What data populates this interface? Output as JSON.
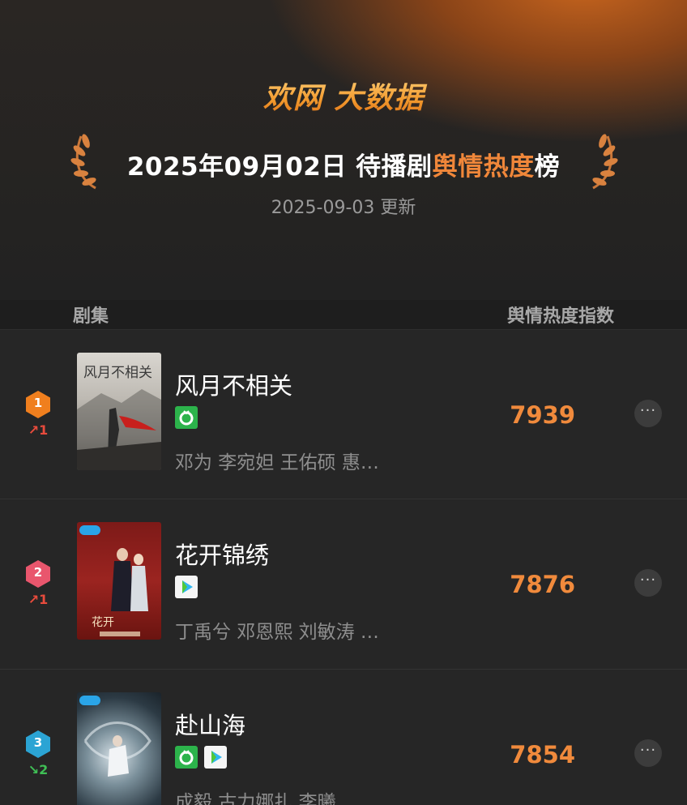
{
  "header": {
    "brand": "欢网 大数据",
    "title_prefix": "2025年09月02日 待播剧",
    "title_highlight": "舆情热度",
    "title_suffix": "榜",
    "updated": "2025-09-03 更新"
  },
  "columns": {
    "left": "剧集",
    "right": "舆情热度指数"
  },
  "colors": {
    "accent": "#f0873a",
    "rank1": "#f07f1e",
    "rank2": "#e9566d",
    "rank3": "#2ba4d4",
    "trend_up": "#e84b3c",
    "trend_down": "#3fbf55"
  },
  "rows": [
    {
      "rank": "1",
      "trend": "↗1",
      "trend_dir": "up",
      "poster_text": "风月不相关",
      "title": "风月不相关",
      "platforms": [
        "iqiyi-icon"
      ],
      "cast": "邓为 李宛妲 王佑硕 惠…",
      "score": "7939"
    },
    {
      "rank": "2",
      "trend": "↗1",
      "trend_dir": "up",
      "poster_text": "",
      "title": "花开锦绣",
      "platforms": [
        "tencent-video-icon"
      ],
      "cast": "丁禹兮 邓恩熙 刘敏涛 …",
      "score": "7876"
    },
    {
      "rank": "3",
      "trend": "↘2",
      "trend_dir": "down",
      "poster_text": "",
      "title": "赴山海",
      "platforms": [
        "iqiyi-icon",
        "tencent-video-icon"
      ],
      "cast": "成毅 古力娜扎 李曦…",
      "score": "7854"
    }
  ]
}
